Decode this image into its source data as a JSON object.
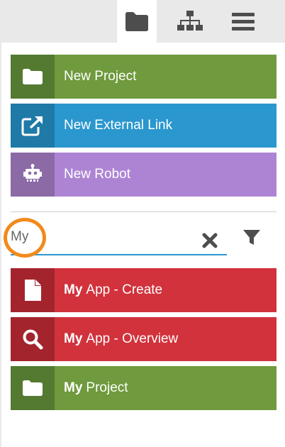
{
  "tabs": [
    {
      "icon": "folder-icon",
      "active": true
    },
    {
      "icon": "sitemap-icon",
      "active": false
    },
    {
      "icon": "menu-icon",
      "active": false
    }
  ],
  "actions": [
    {
      "label": "New Project",
      "icon": "folder-icon",
      "color": "#6f9a3d"
    },
    {
      "label": "New External Link",
      "icon": "external-link-icon",
      "color": "#2a97ce"
    },
    {
      "label": "New Robot",
      "icon": "robot-icon",
      "color": "#ad84d4"
    }
  ],
  "search": {
    "value": "My",
    "clear_icon": "close-icon",
    "filter_icon": "filter-icon"
  },
  "results": [
    {
      "match": "My",
      "rest": "App - Create",
      "icon": "file-icon",
      "color": "#d1323c"
    },
    {
      "match": "My",
      "rest": "App - Overview",
      "icon": "search-icon",
      "color": "#d1323c"
    },
    {
      "match": "My",
      "rest": "Project",
      "icon": "folder-icon",
      "color": "#6f9a3d"
    }
  ],
  "colors": {
    "accent": "#2a97ce",
    "highlight": "#f28a1a"
  }
}
